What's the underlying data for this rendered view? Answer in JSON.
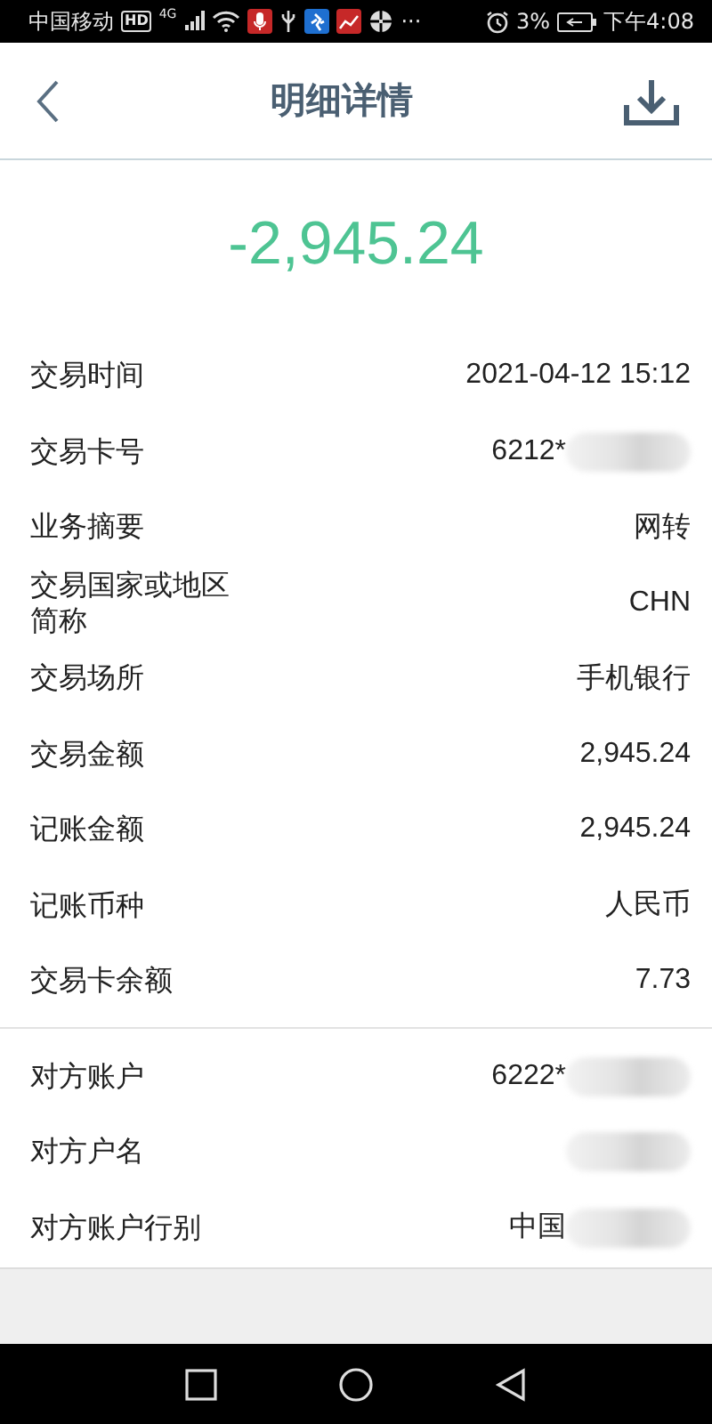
{
  "status_bar": {
    "carrier": "中国移动",
    "hd_badge": "HD",
    "network": "4G",
    "more": "···",
    "battery_percent": "3%",
    "time": "下午4:08"
  },
  "header": {
    "title": "明细详情"
  },
  "amount": "-2,945.24",
  "groups": [
    {
      "rows": [
        {
          "label": "交易时间",
          "value": "2021-04-12 15:12"
        },
        {
          "label": "交易卡号",
          "value": "6212*",
          "redacted": true
        },
        {
          "label": "业务摘要",
          "value": "网转"
        },
        {
          "label": "交易国家或地区简称",
          "value": "CHN"
        },
        {
          "label": "交易场所",
          "value": "手机银行"
        },
        {
          "label": "交易金额",
          "value": "2,945.24"
        },
        {
          "label": "记账金额",
          "value": "2,945.24"
        },
        {
          "label": "记账币种",
          "value": "人民币"
        },
        {
          "label": "交易卡余额",
          "value": "7.73"
        }
      ]
    },
    {
      "rows": [
        {
          "label": "对方账户",
          "value": "6222*",
          "redacted": true
        },
        {
          "label": "对方户名",
          "redacted": true
        },
        {
          "label": "对方账户行别",
          "value": "中国",
          "redacted": true
        }
      ]
    }
  ]
}
